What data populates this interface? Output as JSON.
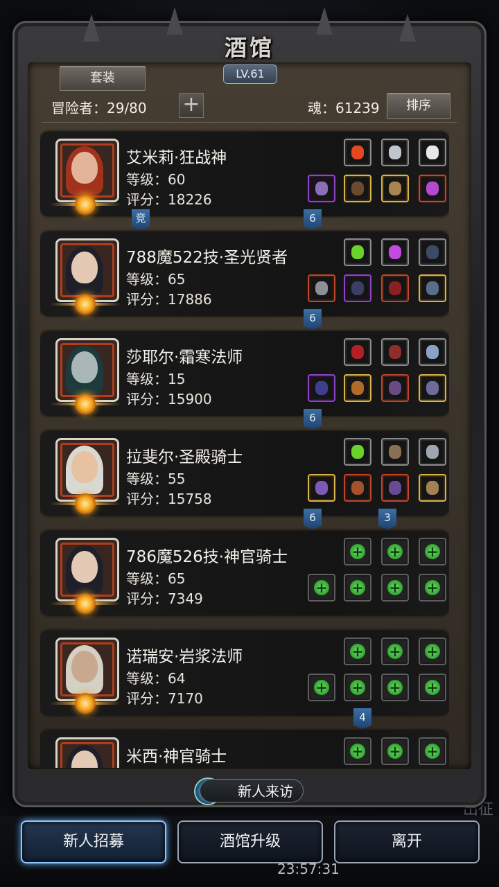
{
  "title": "酒馆",
  "level": "LV.61",
  "set_button": "套装",
  "adventurers_label": "冒险者：29/80",
  "souls_label": "魂：61239",
  "sort_button": "排序",
  "visit_label": "新人来访",
  "bottom_buttons": [
    "新人招募",
    "酒馆升级",
    "离开"
  ],
  "clock": "23:57:31",
  "side_text": "出征",
  "cards": [
    {
      "name": "艾米莉·狂战神",
      "level": "等级：60",
      "score": "评分：18226",
      "tags": [
        "竞",
        "6"
      ]
    },
    {
      "name": "788魔522技·圣光贤者",
      "level": "等级：65",
      "score": "评分：17886",
      "tags": [
        "6"
      ]
    },
    {
      "name": "莎耶尔·霜寒法师",
      "level": "等级：15",
      "score": "评分：15900",
      "tags": [
        "6"
      ]
    },
    {
      "name": "拉斐尔·圣殿骑士",
      "level": "等级：55",
      "score": "评分：15758",
      "tags": [
        "6",
        "3"
      ]
    },
    {
      "name": "786魔526技·神官骑士",
      "level": "等级：65",
      "score": "评分：7349",
      "tags": []
    },
    {
      "name": "诺瑞安·岩浆法师",
      "level": "等级：64",
      "score": "评分：7170",
      "tags": [
        "4"
      ]
    },
    {
      "name": "米西·神官骑士",
      "level": "",
      "score": "",
      "tags": []
    }
  ],
  "colors": {
    "gold": "#d8b54a",
    "accent_blue": "#3b6fa3",
    "green_plus": "#2c9a2a"
  }
}
